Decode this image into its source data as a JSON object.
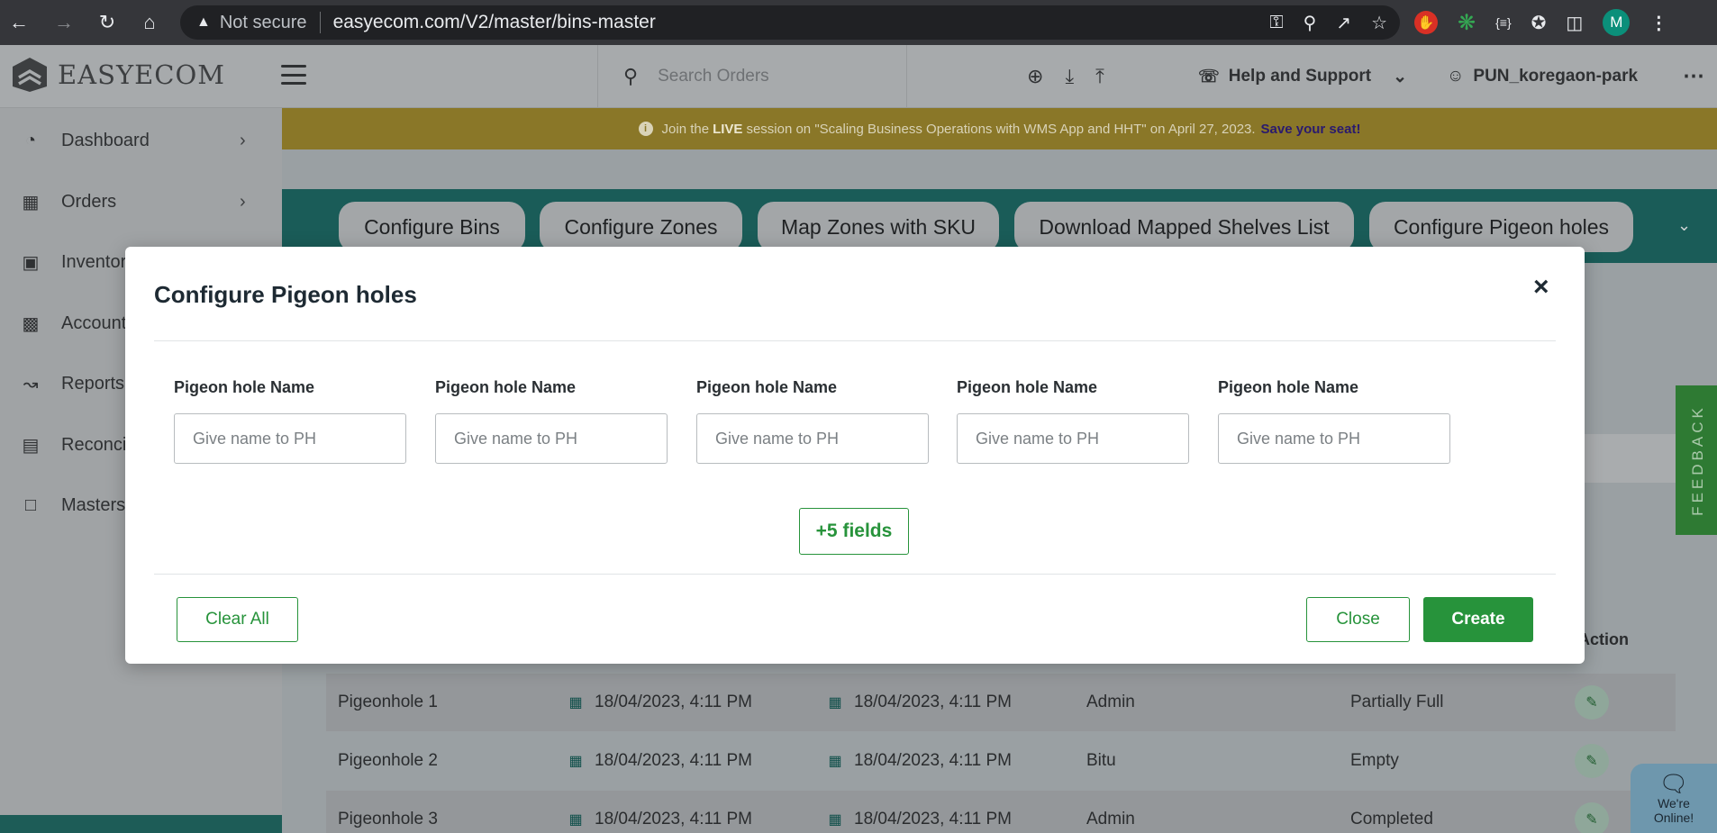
{
  "browser": {
    "not_secure": "Not secure",
    "url": "easyecom.com/V2/master/bins-master",
    "avatar_letter": "M"
  },
  "header": {
    "logo_text": "EASYECOM",
    "search_placeholder": "Search Orders",
    "help_label": "Help and Support",
    "user_label": "PUN_koregaon-park"
  },
  "sidebar": {
    "items": [
      {
        "label": "Dashboard",
        "icon": "dashboard-icon"
      },
      {
        "label": "Orders",
        "icon": "orders-icon"
      },
      {
        "label": "Inventory",
        "icon": "inventory-icon"
      },
      {
        "label": "Accounts",
        "icon": "accounts-icon"
      },
      {
        "label": "Reports",
        "icon": "reports-icon"
      },
      {
        "label": "Reconciliation",
        "icon": "reconciliation-icon"
      },
      {
        "label": "Masters",
        "icon": "masters-icon"
      }
    ]
  },
  "banner": {
    "prefix": "Join the",
    "live": "LIVE",
    "text": "session on \"Scaling Business Operations with WMS App and HHT\" on April 27, 2023.",
    "link": "Save your seat!"
  },
  "tabs": [
    "Configure Bins",
    "Configure Zones",
    "Map Zones with SKU",
    "Download Mapped Shelves List",
    "Configure Pigeon holes"
  ],
  "feedback_label": "FEEDBACK",
  "table": {
    "action_header": "Action",
    "rows": [
      {
        "name": "Pigeonhole 1",
        "created": "18/04/2023, 4:11 PM",
        "updated": "18/04/2023, 4:11 PM",
        "user": "Admin",
        "status": "Partially Full"
      },
      {
        "name": "Pigeonhole 2",
        "created": "18/04/2023, 4:11 PM",
        "updated": "18/04/2023, 4:11 PM",
        "user": "Bitu",
        "status": "Empty"
      },
      {
        "name": "Pigeonhole 3",
        "created": "18/04/2023, 4:11 PM",
        "updated": "18/04/2023, 4:11 PM",
        "user": "Admin",
        "status": "Completed"
      }
    ]
  },
  "chat": {
    "line1": "We're",
    "line2": "Online!"
  },
  "modal": {
    "title": "Configure Pigeon holes",
    "fields": [
      {
        "label": "Pigeon hole Name",
        "placeholder": "Give name to PH",
        "value": ""
      },
      {
        "label": "Pigeon hole Name",
        "placeholder": "Give name to PH",
        "value": ""
      },
      {
        "label": "Pigeon hole Name",
        "placeholder": "Give name to PH",
        "value": ""
      },
      {
        "label": "Pigeon hole Name",
        "placeholder": "Give name to PH",
        "value": ""
      },
      {
        "label": "Pigeon hole Name",
        "placeholder": "Give name to PH",
        "value": ""
      }
    ],
    "more_fields_label": "+5 fields",
    "clear_all_label": "Clear All",
    "close_label": "Close",
    "create_label": "Create"
  },
  "colors": {
    "brand_green": "#27933b",
    "teal": "#1a5c58",
    "banner": "#8a7728"
  }
}
